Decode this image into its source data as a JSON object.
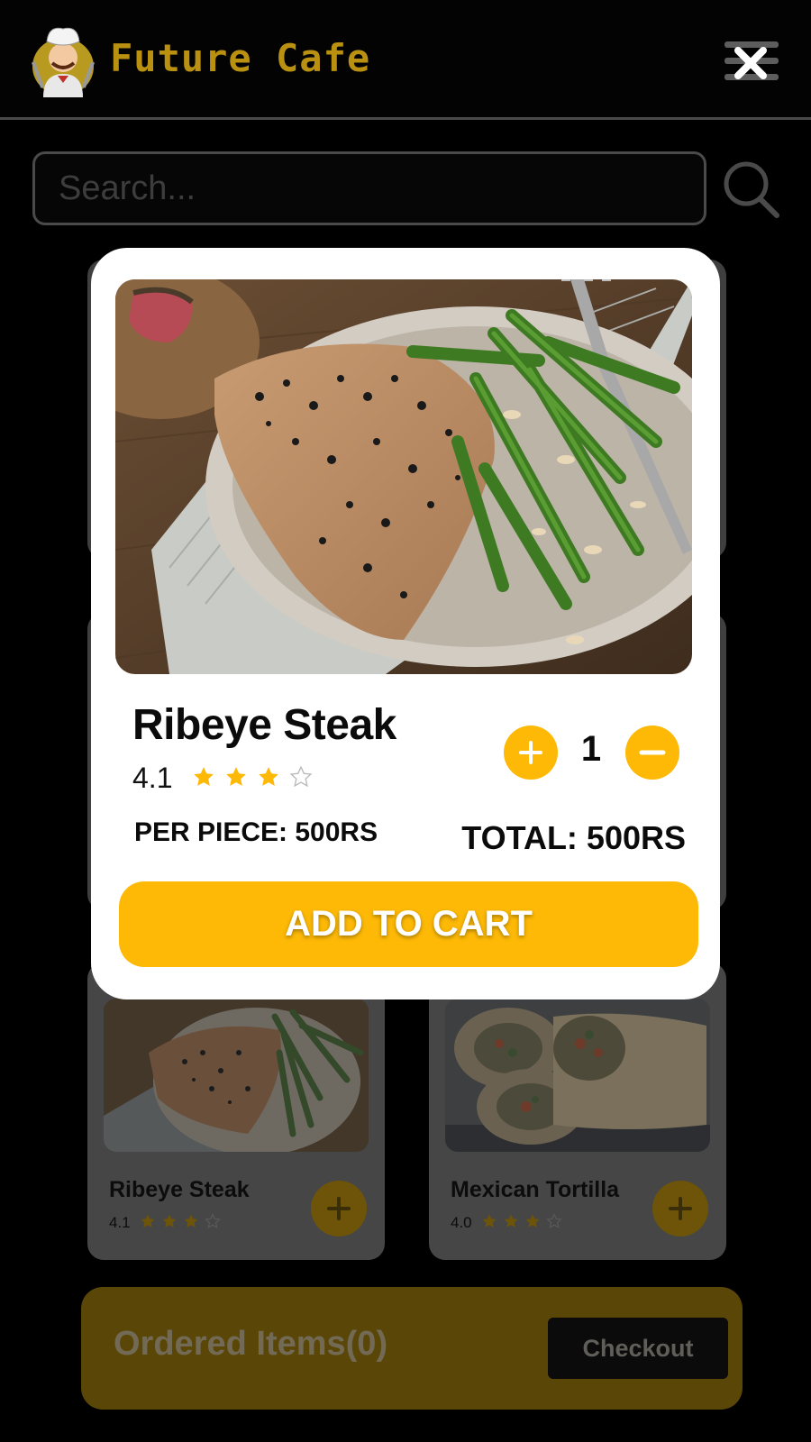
{
  "header": {
    "brand": "Future Cafe",
    "logo_icon": "chef-logo-icon",
    "close_icon": "close-icon",
    "menu_icon": "hamburger-menu-icon"
  },
  "search": {
    "placeholder": "Search...",
    "icon": "search-icon"
  },
  "products": [
    {
      "name": "Ribeye Steak",
      "rating": "4.1",
      "stars_filled": 3,
      "stars_total": 4
    },
    {
      "name": "Mexican Tortilla",
      "rating": "4.0",
      "stars_filled": 3,
      "stars_total": 4
    }
  ],
  "order_bar": {
    "label": "Ordered Items(0)",
    "checkout": "Checkout"
  },
  "modal": {
    "title": "Ribeye Steak",
    "rating": "4.1",
    "stars_filled": 3,
    "stars_total": 4,
    "quantity": "1",
    "per_piece": "PER PIECE: 500RS",
    "total": "TOTAL: 500RS",
    "add_to_cart": "ADD TO CART"
  },
  "colors": {
    "accent": "#fdb906",
    "brand": "#b99010",
    "background": "#000000",
    "modal_bg": "#ffffff"
  }
}
